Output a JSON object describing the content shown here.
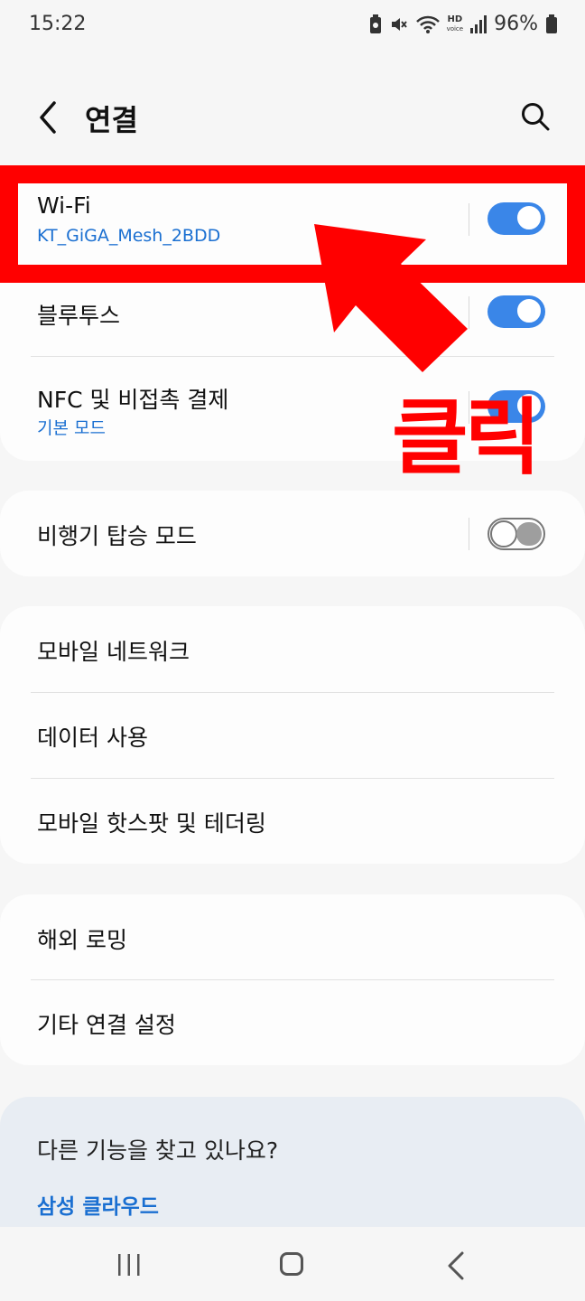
{
  "status_bar": {
    "time": "15:22",
    "hd_label": "HD",
    "voice_label": "voice",
    "battery": "96%"
  },
  "header": {
    "title": "연결"
  },
  "items": {
    "wifi": {
      "label": "Wi-Fi",
      "network": "KT_GiGA_Mesh_2BDD",
      "enabled": true
    },
    "bluetooth": {
      "label": "블루투스",
      "enabled": true
    },
    "nfc": {
      "label": "NFC 및 비접촉 결제",
      "sub": "기본 모드"
    },
    "airplane": {
      "label": "비행기 탑승 모드",
      "enabled": false
    },
    "mobile_network": {
      "label": "모바일 네트워크"
    },
    "data_usage": {
      "label": "데이터 사용"
    },
    "hotspot": {
      "label": "모바일 핫스팟 및 테더링"
    },
    "roaming": {
      "label": "해외 로밍"
    },
    "more": {
      "label": "기타 연결 설정"
    }
  },
  "annotation": {
    "text": "클릭",
    "color": "#ff0000"
  },
  "suggestion": {
    "question": "다른 기능을 찾고 있나요?",
    "link": "삼성 클라우드"
  },
  "colors": {
    "accent": "#3a86e8",
    "link": "#1a6fd1",
    "background": "#f6f6f6",
    "card": "#fdfdfd"
  }
}
